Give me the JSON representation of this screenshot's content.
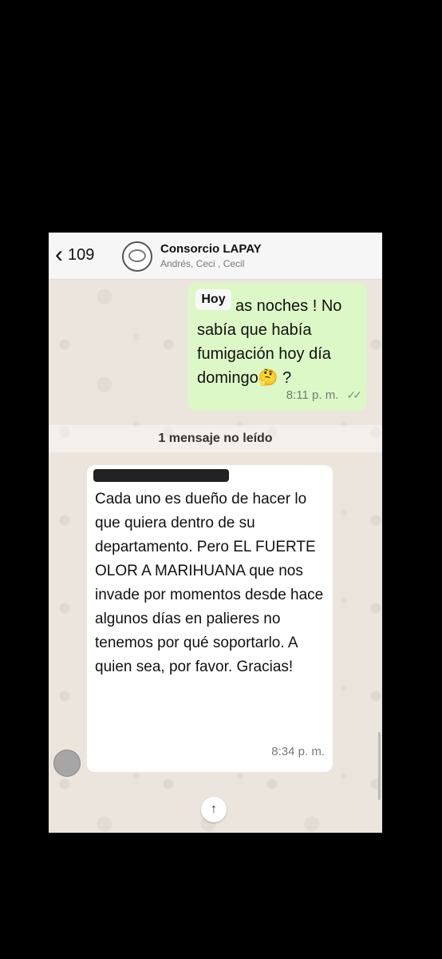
{
  "header": {
    "back_chevron": "‹",
    "unread_count": "109",
    "group_name": "Consorcio LAPAY",
    "members": "Andrés, Ceci , Cecil"
  },
  "outgoing": {
    "chip_label": "Hoy",
    "text": "as noches ! No sabía que había fumigación hoy día domingo🤔 ?",
    "time": "8:11 p. m.",
    "status_icon": "double-check-icon"
  },
  "unread_label": "1 mensaje no leído",
  "incoming": {
    "text": "Cada uno es dueño de hacer lo que quiera dentro de su departamento. Pero EL FUERTE OLOR A MARIHUANA que nos invade por momentos desde hace algunos días en palieres no tenemos por qué soportarlo. A quien sea, por favor. Gracias!",
    "time": "8:34 p. m."
  },
  "scroll_icon": "↑",
  "colors": {
    "outgoing_bubble": "#dcf8c6",
    "incoming_bubble": "#ffffff",
    "wallpaper": "#ece5dd"
  }
}
